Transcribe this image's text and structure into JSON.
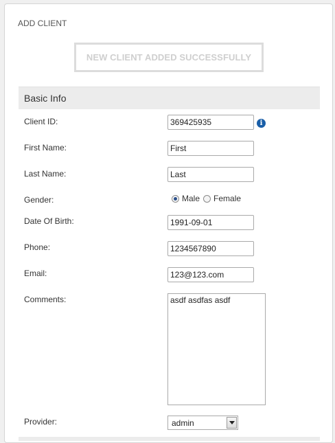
{
  "page": {
    "title": "ADD CLIENT",
    "success_message": "NEW CLIENT ADDED SUCCESSFULLY"
  },
  "section": {
    "title": "Basic Info"
  },
  "form": {
    "client_id": {
      "label": "Client ID:",
      "value": "369425935",
      "info_icon": "info-icon"
    },
    "first_name": {
      "label": "First Name:",
      "value": "First"
    },
    "last_name": {
      "label": "Last Name:",
      "value": "Last"
    },
    "gender": {
      "label": "Gender:",
      "options": [
        "Male",
        "Female"
      ],
      "selected": "Male"
    },
    "dob": {
      "label": "Date Of Birth:",
      "value": "1991-09-01"
    },
    "phone": {
      "label": "Phone:",
      "value": "1234567890"
    },
    "email": {
      "label": "Email:",
      "value": "123@123.com"
    },
    "comments": {
      "label": "Comments:",
      "value": "asdf asdfas asdf"
    },
    "provider": {
      "label": "Provider:",
      "value": "admin"
    }
  },
  "colors": {
    "panel_bg": "#ffffff",
    "section_bg": "#ececec",
    "banner_text": "#cfcfcf",
    "info_icon": "#1a5fa8"
  }
}
